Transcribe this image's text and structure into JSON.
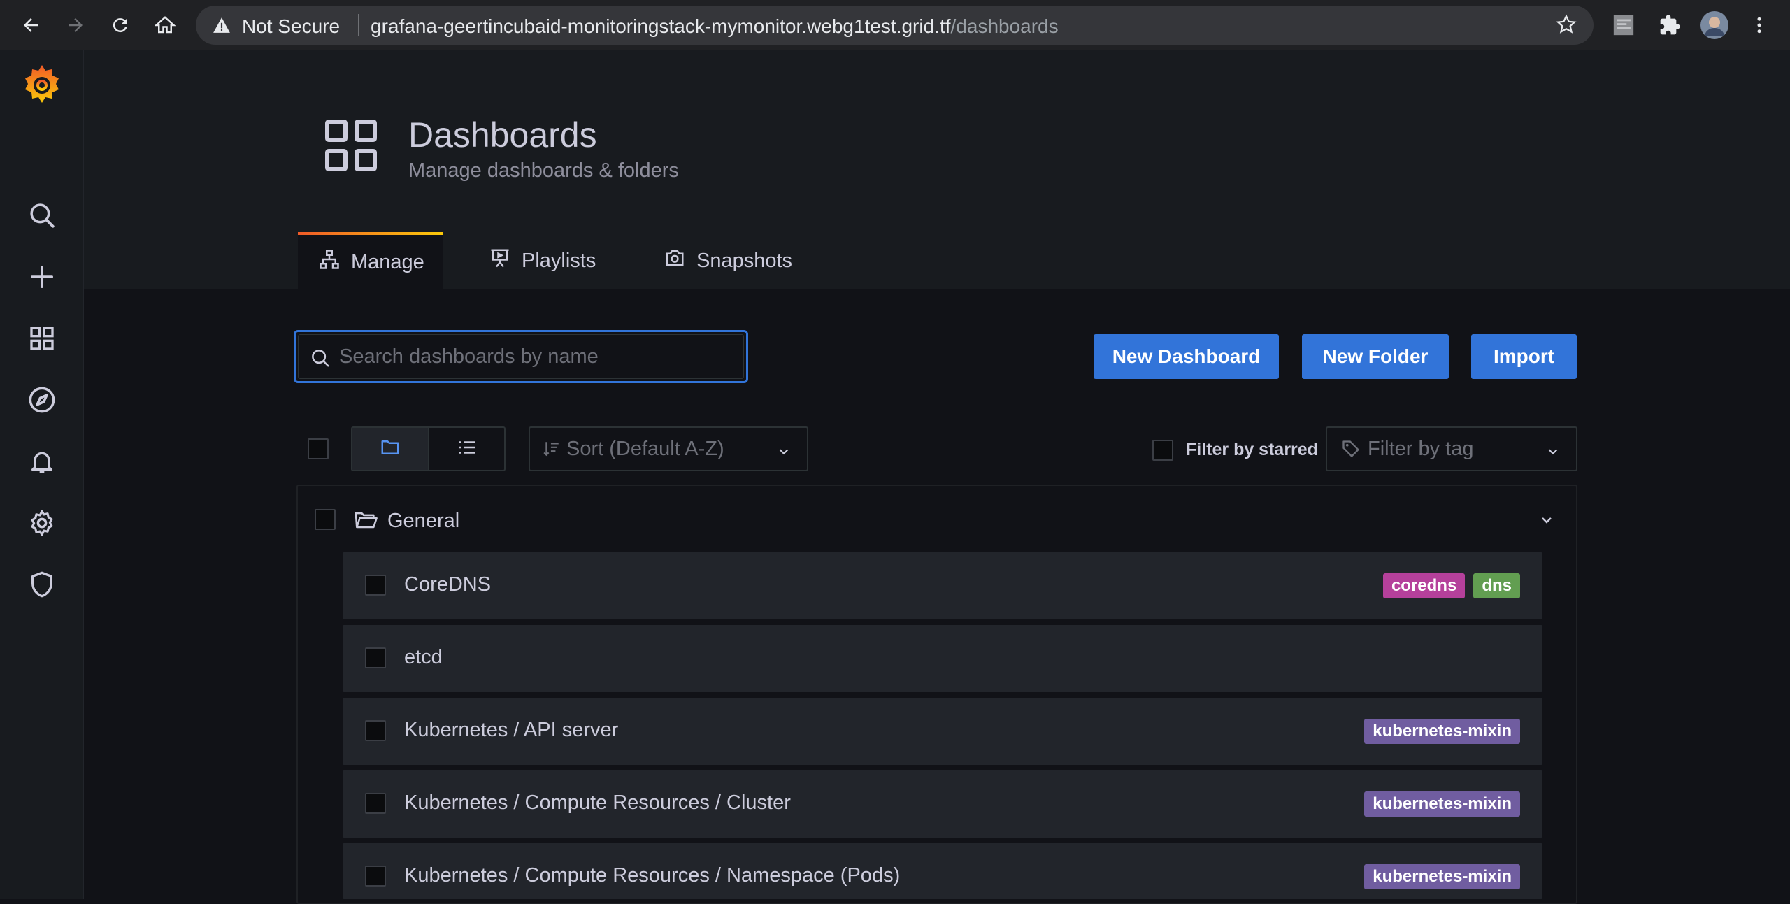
{
  "browser": {
    "security_label": "Not Secure",
    "url_host": "grafana-geertincubaid-monitoringstack-mymonitor.webg1test.grid.tf",
    "url_path": "/dashboards"
  },
  "header": {
    "title": "Dashboards",
    "subtitle": "Manage dashboards & folders"
  },
  "tabs": [
    {
      "label": "Manage",
      "icon": "sitemap-icon"
    },
    {
      "label": "Playlists",
      "icon": "presentation-icon"
    },
    {
      "label": "Snapshots",
      "icon": "camera-icon"
    }
  ],
  "search": {
    "placeholder": "Search dashboards by name"
  },
  "actions": {
    "new_dashboard": "New Dashboard",
    "new_folder": "New Folder",
    "import": "Import"
  },
  "controls": {
    "sort_placeholder": "Sort (Default A-Z)",
    "filter_starred": "Filter by starred",
    "filter_tag_placeholder": "Filter by tag"
  },
  "folder": {
    "name": "General"
  },
  "dashboards": [
    {
      "title": "CoreDNS",
      "tags": [
        "coredns",
        "dns"
      ]
    },
    {
      "title": "etcd",
      "tags": []
    },
    {
      "title": "Kubernetes / API server",
      "tags": [
        "kubernetes-mixin"
      ]
    },
    {
      "title": "Kubernetes / Compute Resources / Cluster",
      "tags": [
        "kubernetes-mixin"
      ]
    },
    {
      "title": "Kubernetes / Compute Resources / Namespace (Pods)",
      "tags": [
        "kubernetes-mixin"
      ]
    }
  ],
  "tag_colors": {
    "coredns": "#b5409b",
    "dns": "#629e51",
    "kubernetes-mixin": "#705da0"
  },
  "colors": {
    "primary": "#3274d9",
    "tab_accent_start": "#f05a28",
    "tab_accent_end": "#fbca0a"
  }
}
